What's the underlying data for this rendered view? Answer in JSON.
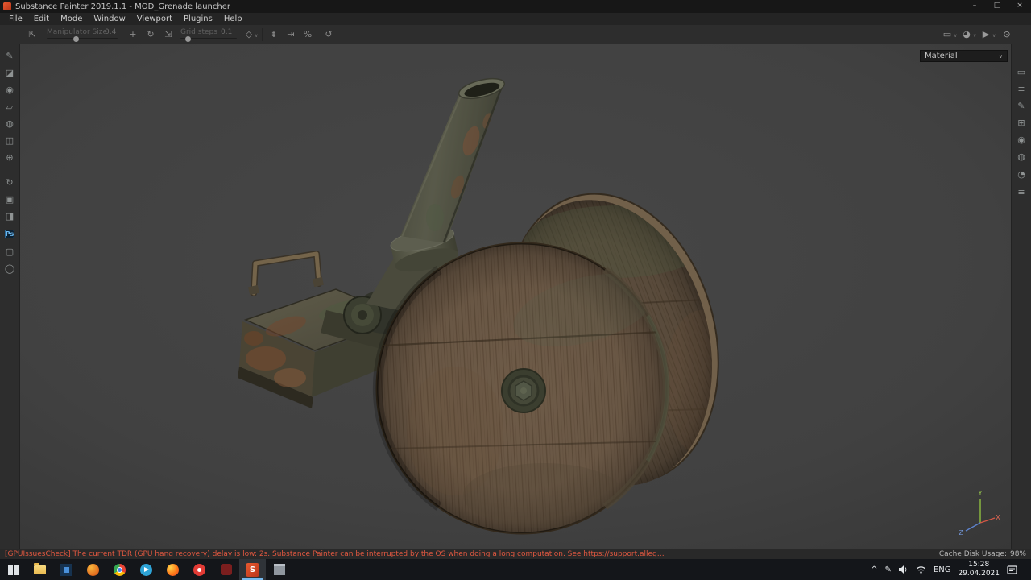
{
  "window": {
    "title": "Substance Painter 2019.1.1 - MOD_Grenade launcher",
    "controls": {
      "minimize": "–",
      "maximize": "□",
      "close": "×"
    }
  },
  "menu": {
    "items": [
      "File",
      "Edit",
      "Mode",
      "Window",
      "Viewport",
      "Plugins",
      "Help"
    ]
  },
  "ui": {
    "caret": "∨"
  },
  "toolbar": {
    "manipulator": {
      "label": "Manipulator Size",
      "value": "0.4"
    },
    "grid": {
      "label": "Grid steps",
      "value": "0.1"
    },
    "icons": {
      "transform": "⇱",
      "move": "+",
      "rotate": "↻",
      "scale": "⇲",
      "snap": "◇",
      "symmetry": "⇟",
      "align": "⇥",
      "percent": "%",
      "reset": "↺"
    },
    "view_icons": {
      "comment": "▭",
      "shader_ball": "◕",
      "video_camera": "▶",
      "photo_camera": "⊙"
    }
  },
  "left_toolbar": {
    "tools": [
      {
        "name": "paint-tool",
        "glyph": "✎"
      },
      {
        "name": "eraser-tool",
        "glyph": "◪"
      },
      {
        "name": "projection-tool",
        "glyph": "◉"
      },
      {
        "name": "polygon-fill-tool",
        "glyph": "▱"
      },
      {
        "name": "smudge-tool",
        "glyph": "◍"
      },
      {
        "name": "clone-tool",
        "glyph": "◫"
      },
      {
        "name": "material-picker-tool",
        "glyph": "⊕"
      }
    ],
    "plugins": [
      {
        "name": "resources-updater-plugin",
        "glyph": "↻"
      },
      {
        "name": "dynamic-material-plugin",
        "glyph": "▣"
      },
      {
        "name": "export-plugin",
        "glyph": "◨"
      },
      {
        "name": "photoshop-export-plugin",
        "glyph": "Ps"
      },
      {
        "name": "screenshot-plugin",
        "glyph": "▢"
      },
      {
        "name": "sphere-plugin",
        "glyph": "◯"
      }
    ]
  },
  "right_sidebar": {
    "panels": [
      {
        "name": "panel-log",
        "glyph": "▭"
      },
      {
        "name": "panel-layers",
        "glyph": "≡"
      },
      {
        "name": "panel-brush",
        "glyph": "✎"
      },
      {
        "name": "panel-texture-sets",
        "glyph": "⊞"
      },
      {
        "name": "panel-camera",
        "glyph": "◉"
      },
      {
        "name": "panel-shader",
        "glyph": "◍"
      },
      {
        "name": "panel-history",
        "glyph": "◔"
      },
      {
        "name": "panel-list",
        "glyph": "≣"
      }
    ]
  },
  "viewport": {
    "material_selector": "Material",
    "gizmo": {
      "x": "X",
      "y": "Y",
      "z": "Z"
    }
  },
  "status_bar": {
    "message": "[GPUIssuesCheck] The current TDR (GPU hang recovery) delay is low: 2s. Substance Painter can be interrupted by the OS when doing a long computation. See https://support.alleg…",
    "cache_label": "Cache Disk Usage:",
    "cache_value": "98%"
  },
  "taskbar": {
    "substance_letter": "S",
    "tray": {
      "chevron": "^",
      "pen": "✎",
      "language": "ENG",
      "time": "15:28",
      "date": "29.04.2021"
    }
  },
  "colors": {
    "accent": "#d94226",
    "warning_text": "#e25840",
    "wood_light": "#6e5b48",
    "wood_dark": "#5d4e3e",
    "metal_green": "#4d5140",
    "rust": "#7a4a30"
  }
}
